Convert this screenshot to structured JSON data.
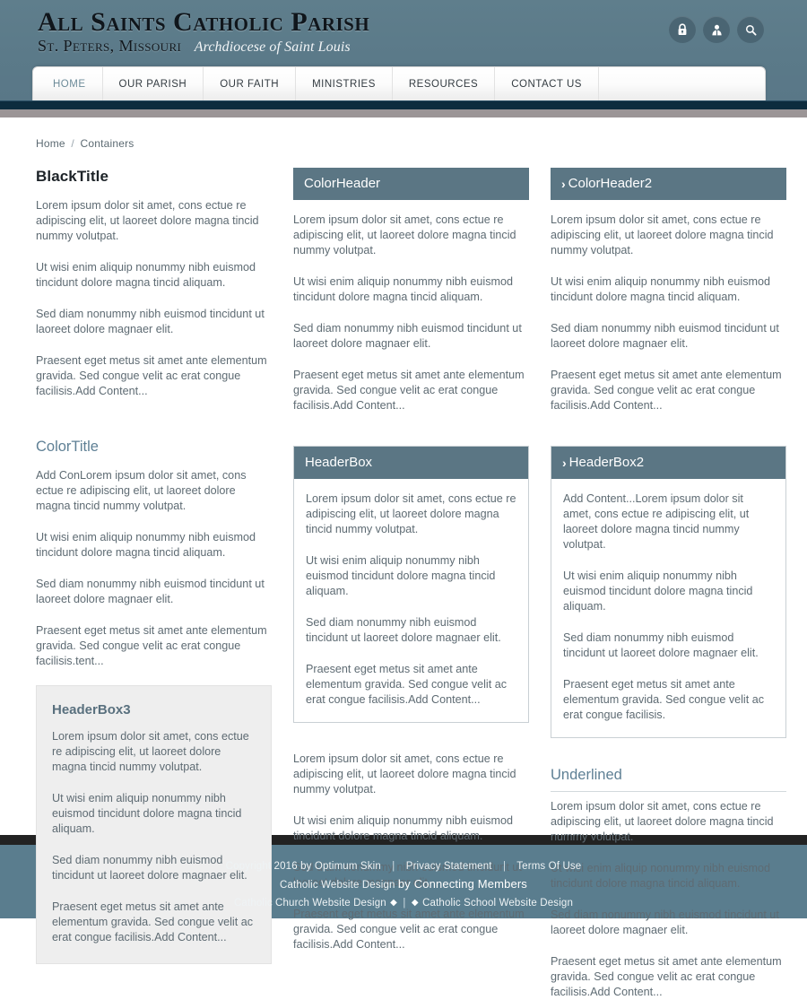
{
  "header": {
    "logo_title": "All Saints Catholic Parish",
    "logo_subtitle": "St. Peters, Missouri",
    "logo_archdiocese": "Archdiocese of Saint Louis",
    "icons": [
      "lock-icon",
      "user-icon",
      "search-icon"
    ],
    "accent_color": "#5b7684",
    "header_bg": "#5b7a89"
  },
  "nav": {
    "items": [
      {
        "label": "HOME",
        "active": true
      },
      {
        "label": "OUR PARISH",
        "active": false
      },
      {
        "label": "OUR FAITH",
        "active": false
      },
      {
        "label": "MINISTRIES",
        "active": false
      },
      {
        "label": "RESOURCES",
        "active": false
      },
      {
        "label": "CONTACT US",
        "active": false
      }
    ]
  },
  "breadcrumb": {
    "home": "Home",
    "separator": "/",
    "current": "Containers"
  },
  "paragraphs": {
    "p1": "Lorem ipsum dolor sit amet, cons ectue re adipiscing elit, ut laoreet dolore magna tincid nummy volutpat.",
    "p1_addcon": "Add ConLorem ipsum dolor sit amet, cons ectue re adipiscing elit, ut laoreet dolore magna tincid nummy volutpat.",
    "p1_addcontent": "Add Content...Lorem ipsum dolor sit amet, cons ectue re adipiscing elit, ut laoreet dolore magna tincid nummy volutpat.",
    "p2": "Ut wisi enim aliquip nonummy nibh euismod tincidunt dolore magna tincid aliquam.",
    "p3": "Sed diam nonummy nibh euismod tincidunt ut laoreet dolore magnaer elit.",
    "p4_addcontent": "Praesent eget metus sit amet ante elementum gravida. Sed congue velit ac erat congue facilisis.Add Content...",
    "p4_tent": "Praesent eget metus sit amet ante elementum gravida. Sed congue velit ac erat congue facilisis.tent...",
    "p4_plain": "Praesent eget metus sit amet ante elementum gravida. Sed congue velit ac erat congue facilisis."
  },
  "column1": {
    "black_title": "BlackTitle",
    "color_title": "ColorTitle",
    "header_box3_title": "HeaderBox3"
  },
  "column2": {
    "color_header": "ColorHeader",
    "header_box_title": "HeaderBox"
  },
  "column3": {
    "color_header2": "ColorHeader2",
    "header_box2_title": "HeaderBox2",
    "underlined_title": "Underlined",
    "chevron": "›"
  },
  "footer": {
    "copyright": "Copyright 2016 by Optimum Skin",
    "privacy": "Privacy Statement",
    "terms": "Terms Of Use",
    "catholic_website_design": "Catholic Website Design",
    "by_connecting_members": "by Connecting Members",
    "church_design": "Catholic Church Website Design",
    "school_design": "Catholic School Website Design",
    "pipe": "|",
    "diamond": "◆",
    "bg_color": "#5a7d8e"
  }
}
